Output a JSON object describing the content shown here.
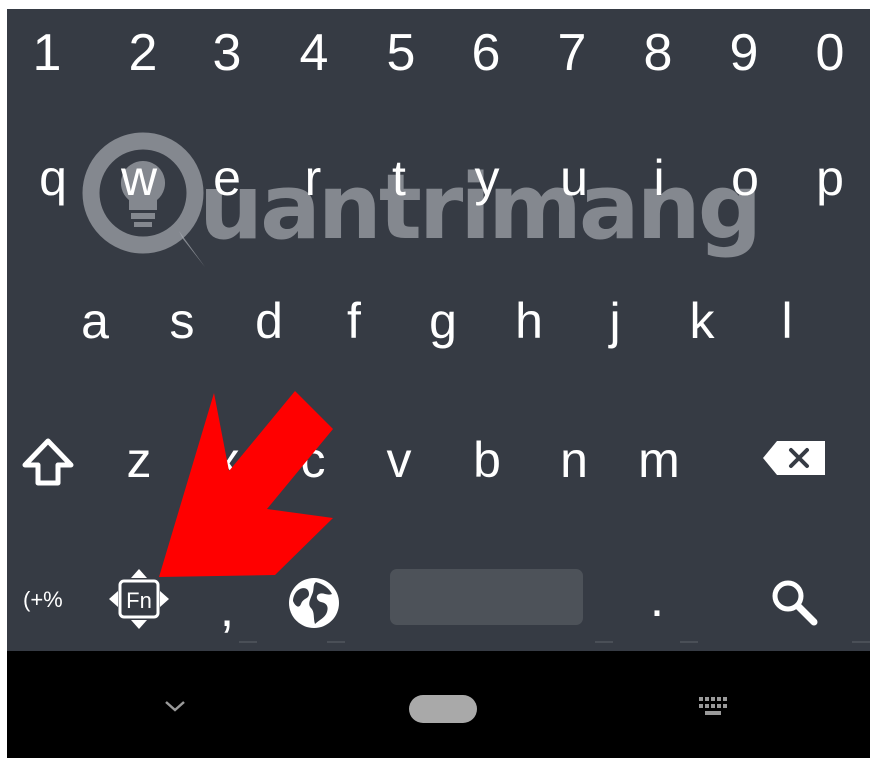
{
  "keyboard": {
    "digits": [
      "1",
      "2",
      "3",
      "4",
      "5",
      "6",
      "7",
      "8",
      "9",
      "0"
    ],
    "row1": [
      "q",
      "w",
      "e",
      "r",
      "t",
      "y",
      "u",
      "i",
      "o",
      "p"
    ],
    "row2": [
      "a",
      "s",
      "d",
      "f",
      "g",
      "h",
      "j",
      "k",
      "l"
    ],
    "row3": [
      "z",
      "x",
      "c",
      "v",
      "b",
      "n",
      "m"
    ],
    "bottom": {
      "symbols_label": "(+%",
      "fn_label": "Fn",
      "comma": ",",
      "period": "."
    },
    "icons": {
      "shift": "shift-icon",
      "backspace": "backspace-icon",
      "fn": "fn-arrows-icon",
      "globe": "globe-icon",
      "search": "search-icon"
    }
  },
  "watermark": {
    "text": "uantrimang",
    "logo": "lightbulb-logo"
  },
  "annotation": {
    "type": "red-arrow",
    "color": "#ff0000",
    "points_to": "fn-key"
  },
  "navbar": {
    "icons": [
      "chevron-down-icon",
      "home-pill-icon",
      "keyboard-icon"
    ]
  },
  "colors": {
    "keyboard_bg": "#363b44",
    "key_text": "#ffffff",
    "spacebar": "#4d5259",
    "navbar_bg": "#000000",
    "arrow": "#ff0000"
  }
}
